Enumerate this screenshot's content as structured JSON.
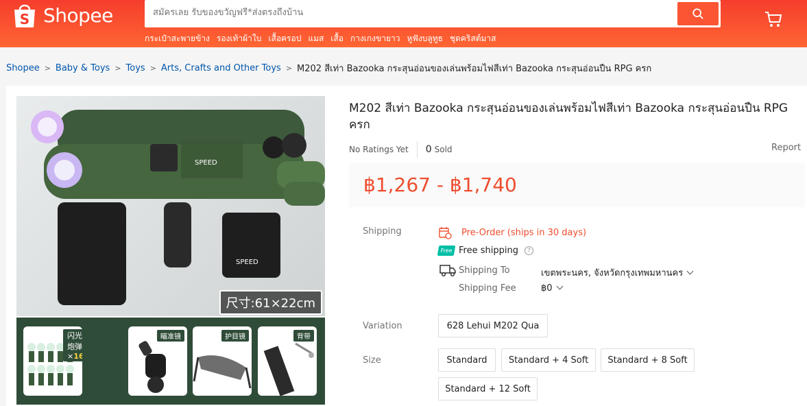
{
  "header": {
    "logo_text": "Shopee",
    "search_placeholder": "สมัครเลย รับของขวัญฟรี*ส่งตรงถึงบ้าน",
    "hints": [
      "กระเป๋าสะพายข้าง",
      "รองเท้าผ้าใบ",
      "เสื้อครอป",
      "แมส",
      "เสื้อ",
      "กางเกงขายาว",
      "หูฟังบลูทูธ",
      "ชุดคริสต์มาส"
    ]
  },
  "breadcrumb": {
    "items": [
      "Shopee",
      "Baby & Toys",
      "Toys",
      "Arts, Crafts and Other Toys"
    ],
    "current": "M202 สีเท่า Bazooka กระสุนอ่อนของเล่นพร้อมไฟสีเท่า Bazooka กระสุนอ่อนปืน RPG ครก"
  },
  "product": {
    "title": "M202 สีเท่า Bazooka กระสุนอ่อนของเล่นพร้อมไฟสีเท่า Bazooka กระสุนอ่อนปืน RPG ครก",
    "ratings": "No Ratings Yet",
    "sold_count": "0",
    "sold_label": "Sold",
    "report": "Report",
    "price": "฿1,267 - ฿1,740",
    "image_size_tag": "尺寸:61×22cm",
    "thumbs": [
      {
        "label_pre": "闪光炮弹×",
        "label_num": "16"
      },
      {
        "label": "瞄准镜"
      },
      {
        "label": "护目镜"
      },
      {
        "label": "背带"
      }
    ]
  },
  "shipping": {
    "label": "Shipping",
    "preorder": "Pre-Order (ships in 30 days)",
    "free_badge": "Free",
    "free_shipping": "Free shipping",
    "to_label": "Shipping To",
    "to_value": "เขตพระนคร, จังหวัดกรุงเทพมหานคร",
    "fee_label": "Shipping Fee",
    "fee_value": "฿0"
  },
  "variation": {
    "label": "Variation",
    "options": [
      "628 Lehui M202 Qua"
    ]
  },
  "size": {
    "label": "Size",
    "options": [
      "Standard",
      "Standard + 4 Soft",
      "Standard + 8 Soft",
      "Standard + 12 Soft"
    ]
  },
  "colors": {
    "brand": "#ee4d2d",
    "link": "#0055aa",
    "free_badge": "#00bfa5"
  }
}
